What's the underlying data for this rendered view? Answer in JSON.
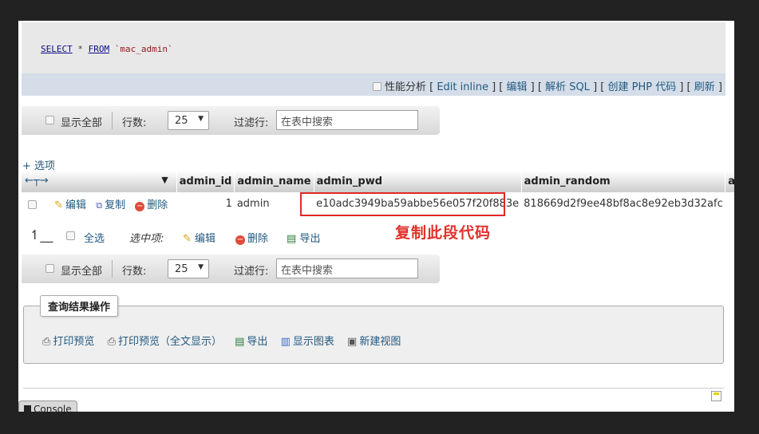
{
  "sql": {
    "select": "SELECT",
    "star": " * ",
    "from": "FROM",
    "table": " `mac_admin`"
  },
  "link_bar": {
    "profiling": "性能分析",
    "links": [
      "Edit inline",
      "编辑",
      "解析 SQL",
      "创建 PHP 代码",
      "刷新"
    ]
  },
  "nav": {
    "show_all": "显示全部",
    "rows_label": "行数:",
    "rows_value": "25",
    "filter_label": "过滤行:",
    "filter_placeholder": "在表中搜索"
  },
  "options_link": "+ 选项",
  "table": {
    "headers": [
      "admin_id",
      "admin_name",
      "admin_pwd",
      "admin_random",
      "admin"
    ],
    "row_actions": {
      "edit": "编辑",
      "copy": "复制",
      "delete": "删除"
    },
    "rows": [
      {
        "admin_id": "1",
        "admin_name": "admin",
        "admin_pwd": "e10adc3949ba59abbe56e057f20f883e",
        "admin_random": "818669d2f9ee48bf8ac8e92eb3d32afc"
      }
    ]
  },
  "annotation": "复制此段代码",
  "bulk": {
    "select_all": "全选",
    "with_selected": "选中项:",
    "edit": "编辑",
    "delete": "删除",
    "export": "导出"
  },
  "ops": {
    "legend": "查询结果操作",
    "links": [
      "打印预览",
      "打印预览（全文显示）",
      "导出",
      "显示图表",
      "新建视图"
    ]
  },
  "console": "Console",
  "colors": {
    "link": "#235a81",
    "highlight": "#e22727"
  }
}
